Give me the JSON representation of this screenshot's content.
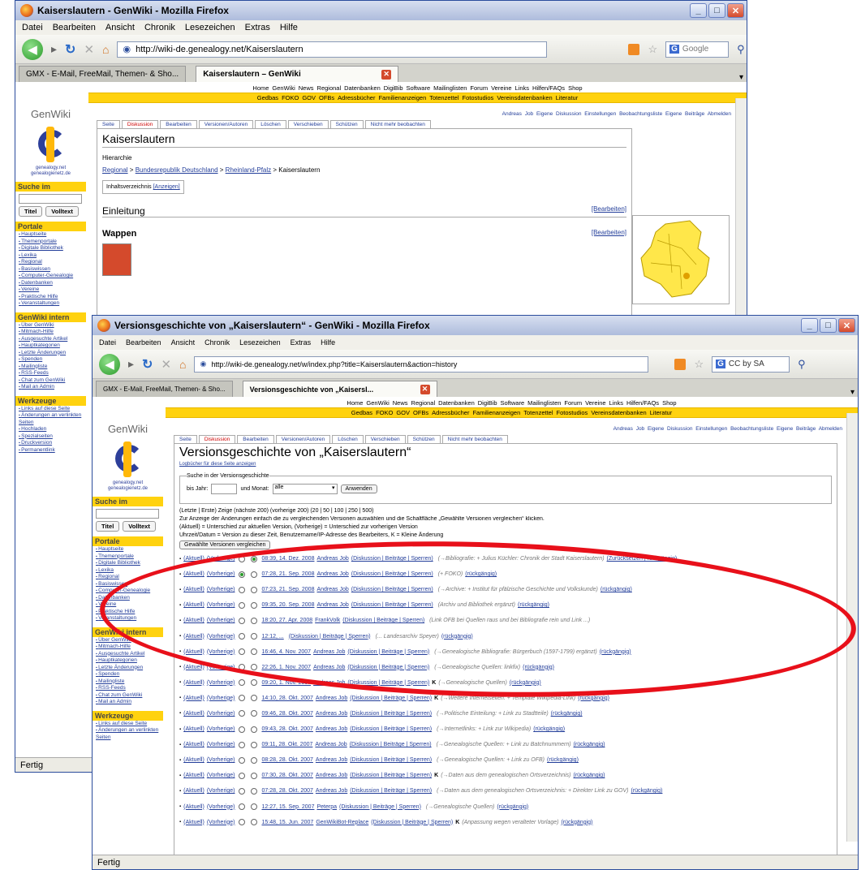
{
  "back_window": {
    "title": "Kaiserslautern - GenWiki - Mozilla Firefox",
    "menu": [
      "Datei",
      "Bearbeiten",
      "Ansicht",
      "Chronik",
      "Lesezeichen",
      "Extras",
      "Hilfe"
    ],
    "url": "http://wiki-de.genealogy.net/Kaiserslautern",
    "search_placeholder": "Google",
    "tabs": [
      "GMX - E-Mail, FreeMail, Themen- & Sho...",
      "Kaiserslautern – GenWiki"
    ],
    "site_menu_1": [
      "Home",
      "GenWiki",
      "News",
      "Regional",
      "Datenbanken",
      "DigiBib",
      "Software",
      "Mailinglisten",
      "Forum",
      "Vereine",
      "Links",
      "Hilfen/FAQs",
      "Shop"
    ],
    "site_menu_2": [
      "Gedbas",
      "FOKO",
      "GOV",
      "OFBs",
      "Adressbücher",
      "Familienanzeigen",
      "Totenzettel",
      "Fotostudios",
      "Vereinsdatenbanken",
      "Literatur"
    ],
    "user_tools": "Andreas Job   Eigene Diskussion   Einstellungen   Beobachtungsliste   Eigene Beiträge   Abmelden",
    "page_tabs": [
      "Seite",
      "Diskussion",
      "Bearbeiten",
      "Versionen/Autoren",
      "Löschen",
      "Verschieben",
      "Schützen",
      "Nicht mehr beobachten"
    ],
    "page_title": "Kaiserslautern",
    "hierarchy_label": "Hierarchie",
    "breadcrumb": [
      "Regional",
      "Bundesrepublik Deutschland",
      "Rheinland-Pfalz",
      "Kaiserslautern"
    ],
    "toc_label": "Inhaltsverzeichnis",
    "toc_show": "[Anzeigen]",
    "section1": "Einleitung",
    "section2": "Wappen",
    "edit_link": "[Bearbeiten]",
    "status": "Fertig"
  },
  "sidebar": {
    "logo_title": "GenWiki",
    "logo_sub": "genealogy.net genealogienetz.de",
    "search_heading": "Suche im",
    "title_btn": "Titel",
    "full_btn": "Volltext",
    "portale_heading": "Portale",
    "portale": [
      "Hauptseite",
      "Themenportale",
      "Digitale Bibliothek",
      "Lexika",
      "Regional",
      "Basiswissen",
      "Computer-Genealogie",
      "Datenbanken",
      "Vereine",
      "Praktische Hilfe",
      "Veranstaltungen"
    ],
    "intern_heading": "GenWiki intern",
    "intern": [
      "Über GenWiki",
      "Mitmach-Hilfe",
      "Ausgesuchte Artikel",
      "Hauptkategorien",
      "Letzte Änderungen",
      "Spenden",
      "Mailingliste",
      "RSS-Feeds",
      "Chat zum GenWiki",
      "Mail an Admin"
    ],
    "tools_heading": "Werkzeuge",
    "tools": [
      "Links auf diese Seite",
      "Änderungen an verlinkten Seiten",
      "Hochladen",
      "Spezialseiten",
      "Druckversion",
      "Permanentlink"
    ]
  },
  "front_window": {
    "title": "Versionsgeschichte von „Kaiserslautern“ - GenWiki - Mozilla Firefox",
    "url": "http://wiki-de.genealogy.net/w/index.php?title=Kaiserslautern&action=history",
    "search_placeholder": "CC by SA",
    "tabs": [
      "GMX - E-Mail, FreeMail, Themen- & Sho...",
      "Versionsgeschichte von „Kaisersl..."
    ],
    "page_title": "Versionsgeschichte von „Kaiserslautern“",
    "log_link": "Logbücher für diese Seite anzeigen",
    "search_legend": "Suche in der Versionsgeschichte",
    "year_label": "bis Jahr:",
    "month_label": "und Monat:",
    "month_value": "alle",
    "apply_btn": "Anwenden",
    "paging": "(Letzte | Erste) Zeige (nächste 200) (vorherige 200) (20 | 50 | 100 | 250 | 500)",
    "legend1": "Zur Anzeige der Änderungen einfach die zu vergleichenden Versionen auswählen und die Schaltfläche „Gewählte Versionen vergleichen“ klicken.",
    "legend2": "(Aktuell) = Unterschied zur aktuellen Version, (Vorherige) = Unterschied zur vorherigen Version",
    "legend3": "Uhrzeit/Datum = Version zu dieser Zeit, Benutzername/IP-Adresse des Bearbeiters, K = Kleine Änderung",
    "compare_btn": "Gewählte Versionen vergleichen",
    "status": "Fertig",
    "rows": [
      {
        "aktuell": "(Aktuell)",
        "vorherige": "(Vorherige)",
        "date": "08:39, 14. Dez. 2008",
        "user": "Andreas Job",
        "links": "(Diskussion | Beiträge | Sperren)",
        "k": "",
        "comment": "(→Bibliografie: + Julius Küchler: Chronik der Stadt Kaiserslautern)",
        "tail": "(Zurücksetzen | rückgängig)"
      },
      {
        "aktuell": "(Aktuell)",
        "vorherige": "(Vorherige)",
        "date": "07:28, 21. Sep. 2008",
        "user": "Andreas Job",
        "links": "(Diskussion | Beiträge | Sperren)",
        "k": "",
        "comment": "(+ FOKO)",
        "tail": "(rückgängig)"
      },
      {
        "aktuell": "(Aktuell)",
        "vorherige": "(Vorherige)",
        "date": "07:23, 21. Sep. 2008",
        "user": "Andreas Job",
        "links": "(Diskussion | Beiträge | Sperren)",
        "k": "",
        "comment": "(→Archive: + Institut für pfälzische Geschichte und Volkskunde)",
        "tail": "(rückgängig)"
      },
      {
        "aktuell": "(Aktuell)",
        "vorherige": "(Vorherige)",
        "date": "09:35, 20. Sep. 2008",
        "user": "Andreas Job",
        "links": "(Diskussion | Beiträge | Sperren)",
        "k": "",
        "comment": "(Archiv und Bibliothek ergänzt)",
        "tail": "(rückgängig)"
      },
      {
        "aktuell": "(Aktuell)",
        "vorherige": "(Vorherige)",
        "date": "18:20, 27. Apr. 2008",
        "user": "FrankVolk",
        "links": "(Diskussion | Beiträge | Sperren)",
        "k": "",
        "comment": "(Link OFB bei Quellen raus und bei Bibliografie rein und Link ...)",
        "tail": ""
      },
      {
        "aktuell": "(Aktuell)",
        "vorherige": "(Vorherige)",
        "date": "12:12, ...",
        "user": "",
        "links": "(Diskussion | Beiträge | Sperren)",
        "k": "",
        "comment": "(... Landesarchiv Speyer)",
        "tail": "(rückgängig)"
      },
      {
        "aktuell": "(Aktuell)",
        "vorherige": "(Vorherige)",
        "date": "16:46, 4. Nov. 2007",
        "user": "Andreas Job",
        "links": "(Diskussion | Beiträge | Sperren)",
        "k": "",
        "comment": "(→Genealogische Bibliografie: Bürgerbuch (1597-1799) ergänzt)",
        "tail": "(rückgängig)"
      },
      {
        "aktuell": "(Aktuell)",
        "vorherige": "(Vorherige)",
        "date": "22:26, 1. Nov. 2007",
        "user": "Andreas Job",
        "links": "(Diskussion | Beiträge | Sperren)",
        "k": "",
        "comment": "(→Genealogische Quellen: linkfix)",
        "tail": "(rückgängig)"
      },
      {
        "aktuell": "(Aktuell)",
        "vorherige": "(Vorherige)",
        "date": "09:20, 1. Nov. 2007",
        "user": "Andreas Job",
        "links": "(Diskussion | Beiträge | Sperren)",
        "k": "K",
        "comment": "(→Genealogische Quellen)",
        "tail": "(rückgängig)"
      },
      {
        "aktuell": "(Aktuell)",
        "vorherige": "(Vorherige)",
        "date": "14:10, 28. Okt. 2007",
        "user": "Andreas Job",
        "links": "(Diskussion | Beiträge | Sperren)",
        "k": "K",
        "comment": "(→Weitere Internetseiten: + Template Wikipedia-Link)",
        "tail": "(rückgängig)"
      },
      {
        "aktuell": "(Aktuell)",
        "vorherige": "(Vorherige)",
        "date": "09:46, 28. Okt. 2007",
        "user": "Andreas Job",
        "links": "(Diskussion | Beiträge | Sperren)",
        "k": "",
        "comment": "(→Politische Einteilung: + Link zu Stadtteile)",
        "tail": "(rückgängig)"
      },
      {
        "aktuell": "(Aktuell)",
        "vorherige": "(Vorherige)",
        "date": "09:43, 28. Okt. 2007",
        "user": "Andreas Job",
        "links": "(Diskussion | Beiträge | Sperren)",
        "k": "",
        "comment": "(→Internetlinks: + Link zur Wikipedia)",
        "tail": "(rückgängig)"
      },
      {
        "aktuell": "(Aktuell)",
        "vorherige": "(Vorherige)",
        "date": "09:11, 28. Okt. 2007",
        "user": "Andreas Job",
        "links": "(Diskussion | Beiträge | Sperren)",
        "k": "",
        "comment": "(→Genealogische Quellen: + Link zu Batchnummern)",
        "tail": "(rückgängig)"
      },
      {
        "aktuell": "(Aktuell)",
        "vorherige": "(Vorherige)",
        "date": "08:28, 28. Okt. 2007",
        "user": "Andreas Job",
        "links": "(Diskussion | Beiträge | Sperren)",
        "k": "",
        "comment": "(→Genealogische Quellen: + Link zu OFB)",
        "tail": "(rückgängig)"
      },
      {
        "aktuell": "(Aktuell)",
        "vorherige": "(Vorherige)",
        "date": "07:30, 28. Okt. 2007",
        "user": "Andreas Job",
        "links": "(Diskussion | Beiträge | Sperren)",
        "k": "K",
        "comment": "(→Daten aus dem genealogischen Ortsverzeichnis)",
        "tail": "(rückgängig)"
      },
      {
        "aktuell": "(Aktuell)",
        "vorherige": "(Vorherige)",
        "date": "07:28, 28. Okt. 2007",
        "user": "Andreas Job",
        "links": "(Diskussion | Beiträge | Sperren)",
        "k": "",
        "comment": "(→Daten aus dem genealogischen Ortsverzeichnis: + Direkter Link zu GOV)",
        "tail": "(rückgängig)"
      },
      {
        "aktuell": "(Aktuell)",
        "vorherige": "(Vorherige)",
        "date": "12:27, 15. Sep. 2007",
        "user": "Peterpa",
        "links": "(Diskussion | Beiträge | Sperren)",
        "k": "",
        "comment": "(→Genealogische Quellen)",
        "tail": "(rückgängig)"
      },
      {
        "aktuell": "(Aktuell)",
        "vorherige": "(Vorherige)",
        "date": "15:48, 15. Jun. 2007",
        "user": "GenWikiBot-Replace",
        "links": "(Diskussion | Beiträge | Sperren)",
        "k": "K",
        "comment": "(Anpassung wegen veralteter Vorlage)",
        "tail": "(rückgängig)"
      }
    ]
  }
}
